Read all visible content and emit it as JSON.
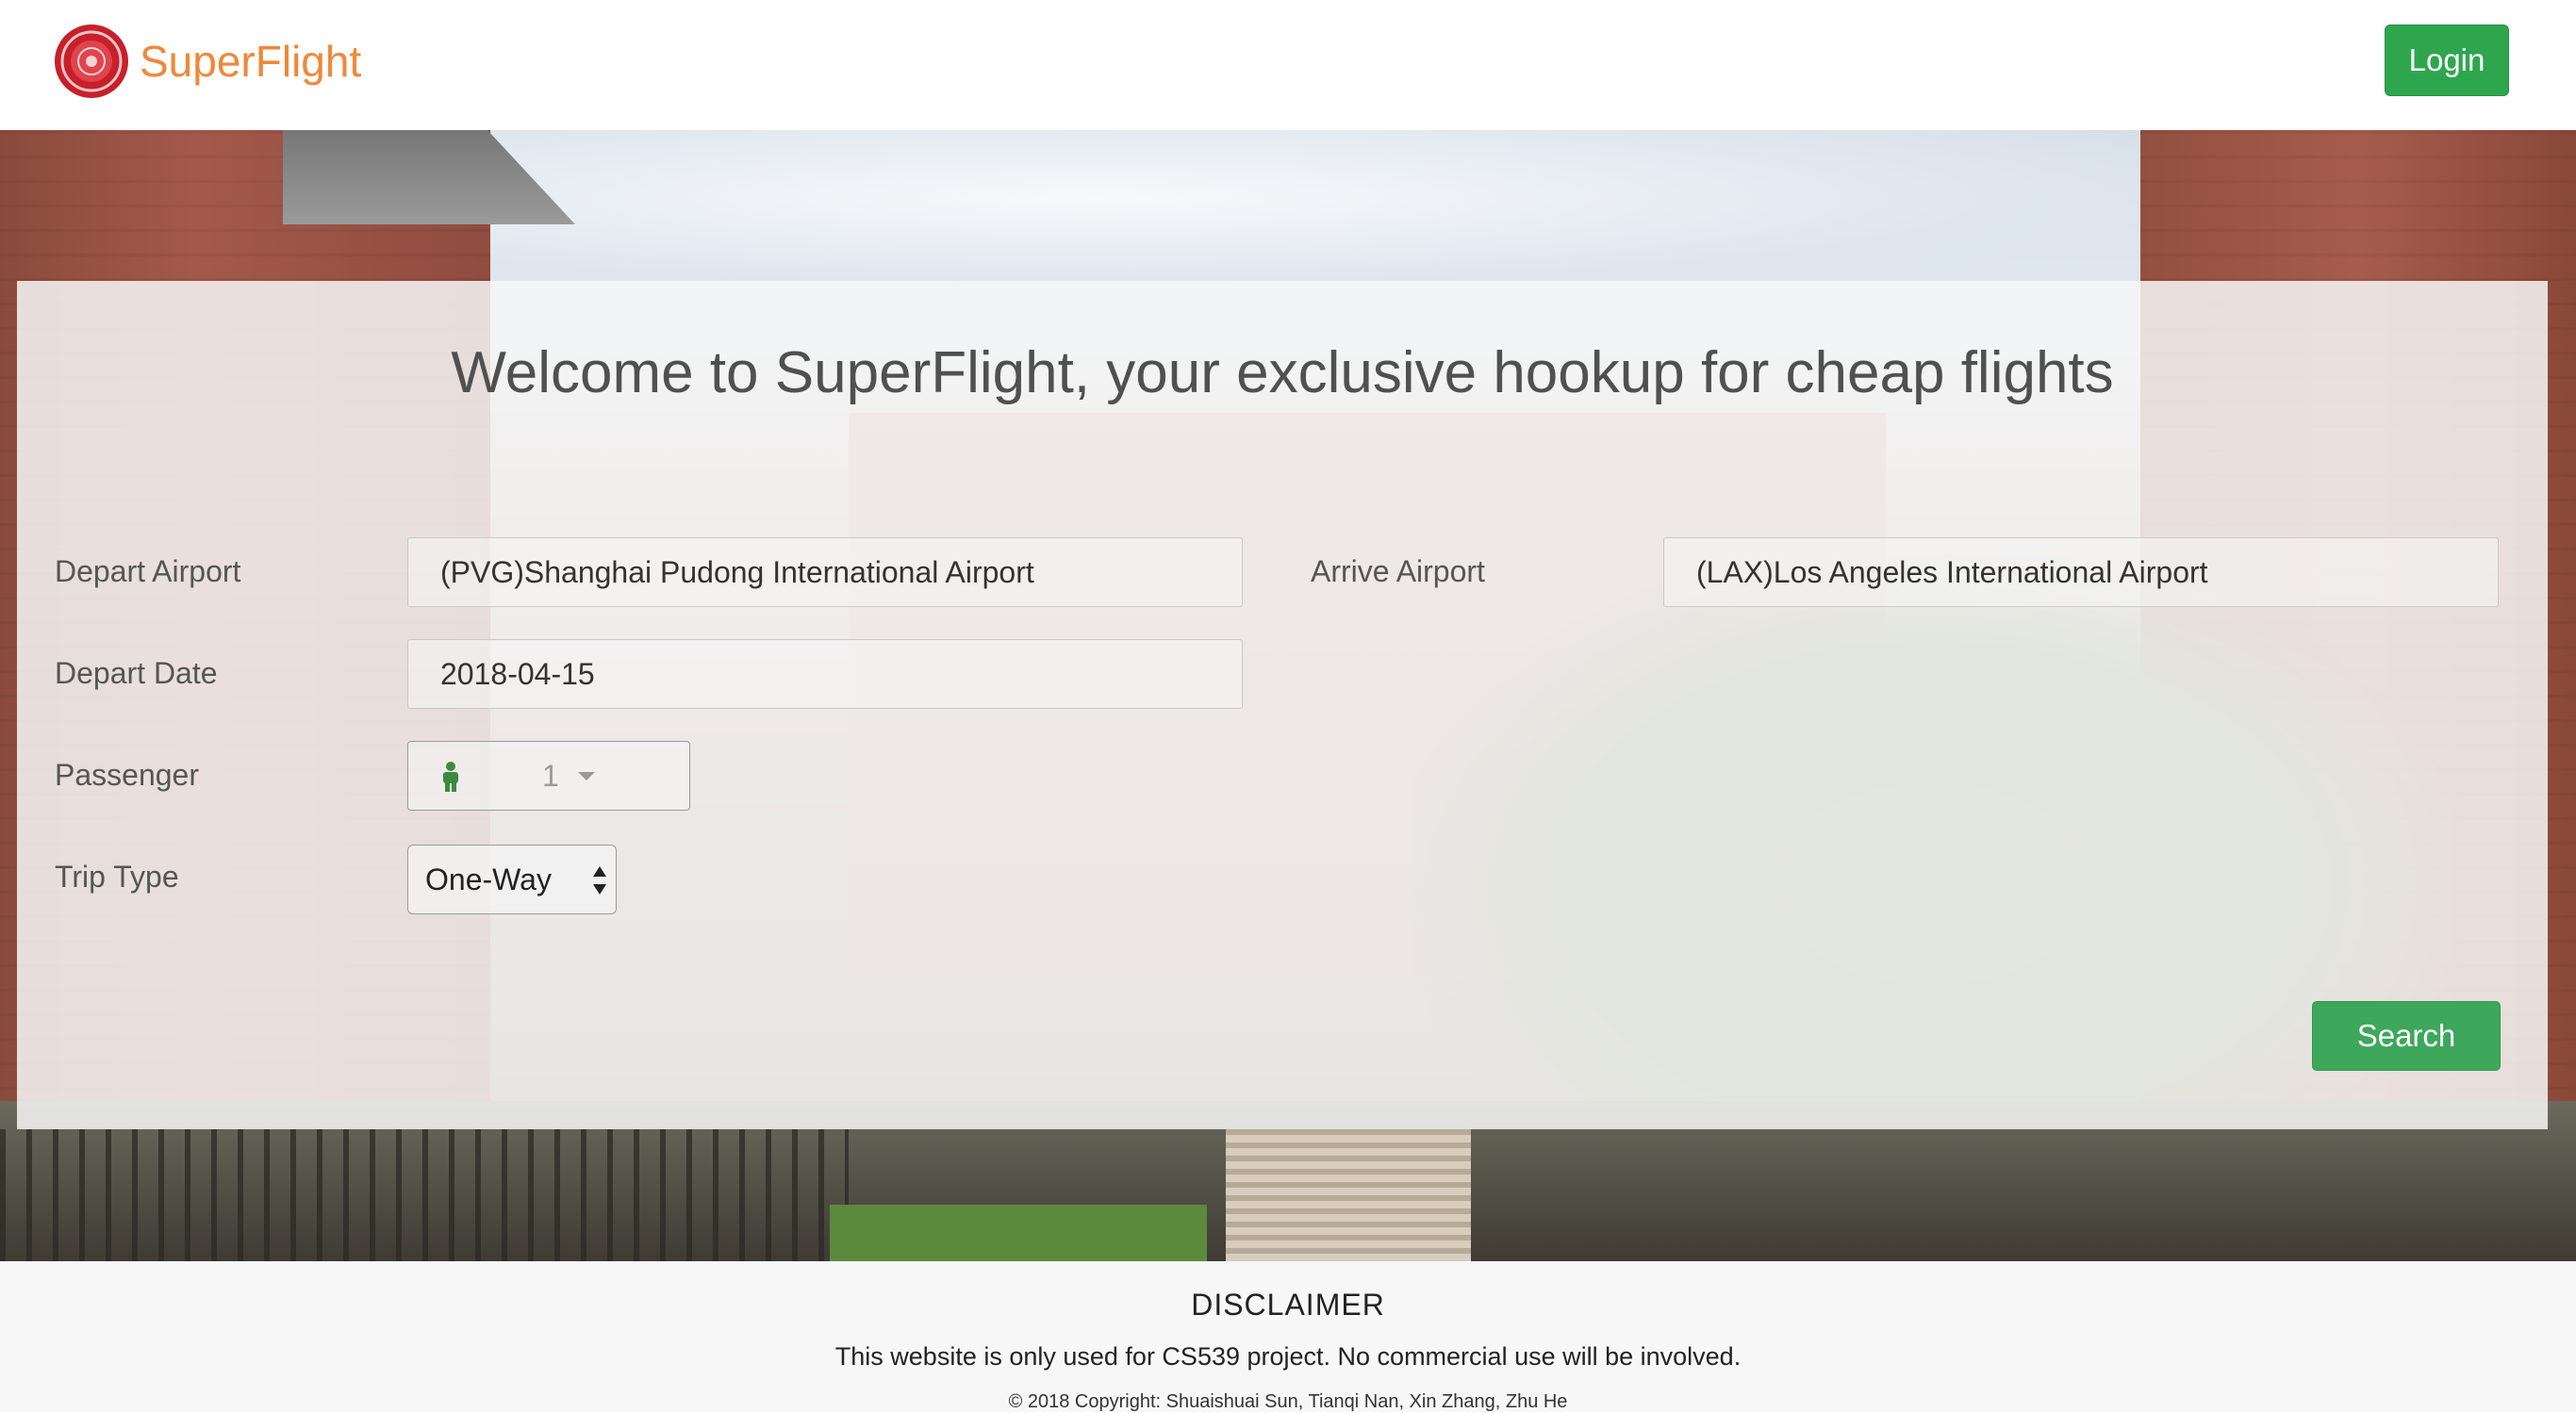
{
  "brand": {
    "name": "SuperFlight",
    "logo_icon": "university-seal-icon"
  },
  "nav": {
    "login_label": "Login"
  },
  "form": {
    "welcome": "Welcome to SuperFlight, your exclusive hookup for cheap flights",
    "depart_airport": {
      "label": "Depart Airport",
      "value": "(PVG)Shanghai Pudong International Airport"
    },
    "arrive_airport": {
      "label": "Arrive Airport",
      "value": "(LAX)Los Angeles International Airport"
    },
    "depart_date": {
      "label": "Depart Date",
      "value": "2018-04-15"
    },
    "passenger": {
      "label": "Passenger",
      "value": "1",
      "icon": "person-icon"
    },
    "trip_type": {
      "label": "Trip Type",
      "value": "One-Way"
    },
    "search_label": "Search"
  },
  "footer": {
    "title": "DISCLAIMER",
    "text": "This website is only used for CS539 project. No commercial use will be involved.",
    "copyright": "© 2018 Copyright: Shuaishuai Sun, Tianqi Nan, Xin Zhang, Zhu He"
  },
  "colors": {
    "brand": "#f0883a",
    "button_green": "#2ea64e",
    "search_green": "#3da85b"
  }
}
